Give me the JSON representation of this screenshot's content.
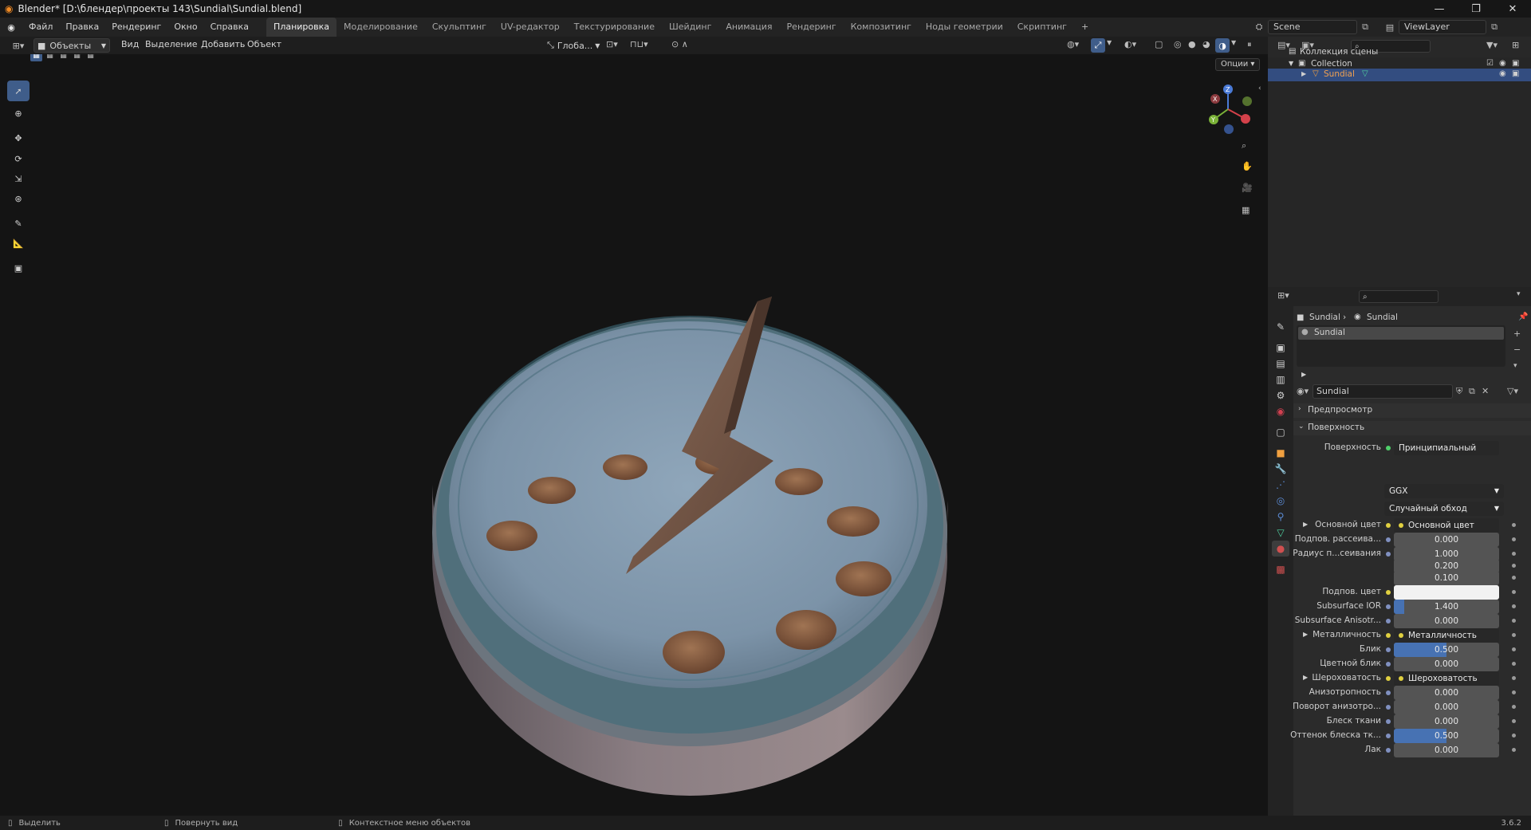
{
  "window": {
    "title": "Blender* [D:\\блендер\\проекты 143\\Sundial\\Sundial.blend]"
  },
  "menu": [
    "Файл",
    "Правка",
    "Рендеринг",
    "Окно",
    "Справка"
  ],
  "workspaces": [
    "Планировка",
    "Моделирование",
    "Скульптинг",
    "UV-редактор",
    "Текстурирование",
    "Шейдинг",
    "Анимация",
    "Рендеринг",
    "Композитинг",
    "Ноды геометрии",
    "Скриптинг"
  ],
  "active_workspace": "Планировка",
  "scene": {
    "name": "Scene",
    "view_layer": "ViewLayer"
  },
  "viewport_header": {
    "mode": "Объекты",
    "menus": [
      "Вид",
      "Выделение",
      "Добавить",
      "Объект"
    ],
    "transform_orientation": "Глоба...",
    "options": "Опции"
  },
  "outliner": {
    "root": "Коллекция сцены",
    "collection": "Collection",
    "object": "Sundial"
  },
  "properties": {
    "breadcrumb": [
      "Sundial",
      "Sundial"
    ],
    "material_slot": "Sundial",
    "material_name": "Sundial",
    "panels": {
      "preview": "Предпросмотр",
      "surface": "Поверхность"
    },
    "surface_label": "Поверхность",
    "surface_value": "Принципиальный BSDF",
    "distribution": "GGX",
    "subsurface_method": "Случайный обход",
    "rows": [
      {
        "label": "Основной цвет",
        "value": "Основной цвет",
        "kind": "link",
        "expand": true
      },
      {
        "label": "Подпов. рассеива...",
        "value": "0.000",
        "fill": 0
      },
      {
        "label": "Радиус п...сеивания",
        "value": "1.000",
        "fill": 0
      },
      {
        "label": "",
        "value": "0.200",
        "fill": 0
      },
      {
        "label": "",
        "value": "0.100",
        "fill": 0
      },
      {
        "label": "Подпов. цвет",
        "value": "",
        "kind": "color"
      },
      {
        "label": "Subsurface IOR",
        "value": "1.400",
        "fill": 0.1
      },
      {
        "label": "Subsurface Anisotr...",
        "value": "0.000",
        "fill": 0
      },
      {
        "label": "Металличность",
        "value": "Металличность",
        "kind": "link",
        "expand": true
      },
      {
        "label": "Блик",
        "value": "0.500",
        "fill": 0.5
      },
      {
        "label": "Цветной блик",
        "value": "0.000",
        "fill": 0
      },
      {
        "label": "Шероховатость",
        "value": "Шероховатость",
        "kind": "link",
        "expand": true
      },
      {
        "label": "Анизотропность",
        "value": "0.000",
        "fill": 0
      },
      {
        "label": "Поворот анизотро...",
        "value": "0.000",
        "fill": 0
      },
      {
        "label": "Блеск ткани",
        "value": "0.000",
        "fill": 0
      },
      {
        "label": "Оттенок блеска тк...",
        "value": "0.500",
        "fill": 0.5
      },
      {
        "label": "Лак",
        "value": "0.000",
        "fill": 0
      }
    ]
  },
  "statusbar": {
    "select": "Выделить",
    "rotate": "Повернуть вид",
    "context": "Контекстное меню объектов",
    "version": "3.6.2"
  },
  "colors": {
    "accent": "#4772b3",
    "active_tool": "#3f5d8a",
    "viewport_bg": "#141414"
  }
}
